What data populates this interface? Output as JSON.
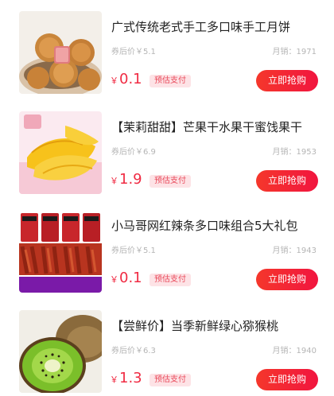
{
  "products": [
    {
      "title": "广式传统老式手工多口味手工月饼",
      "old_price": "券后价￥5.1",
      "sales": "月销：1971",
      "currency": "￥",
      "price": "0.1",
      "prepay_label": "预估支付",
      "buy_label": "立即抢购"
    },
    {
      "title": "【茉莉甜甜】芒果干水果干蜜饯果干",
      "old_price": "券后价￥6.9",
      "sales": "月销：1953",
      "currency": "￥",
      "price": "1.9",
      "prepay_label": "预估支付",
      "buy_label": "立即抢购"
    },
    {
      "title": "小马哥网红辣条多口味组合5大礼包",
      "old_price": "券后价￥5.1",
      "sales": "月销：1943",
      "currency": "￥",
      "price": "0.1",
      "prepay_label": "预估支付",
      "buy_label": "立即抢购",
      "image_banner": "全新升级 好吃不贵"
    },
    {
      "title": "【尝鲜价】当季新鲜绿心猕猴桃",
      "old_price": "券后价￥6.3",
      "sales": "月销：1940",
      "currency": "￥",
      "price": "1.3",
      "prepay_label": "预估支付",
      "buy_label": "立即抢购"
    }
  ],
  "colors": {
    "accent": "#f02b43",
    "button_gradient_start": "#f5372b",
    "button_gradient_end": "#f1153f",
    "badge_bg": "#fde3e6"
  }
}
